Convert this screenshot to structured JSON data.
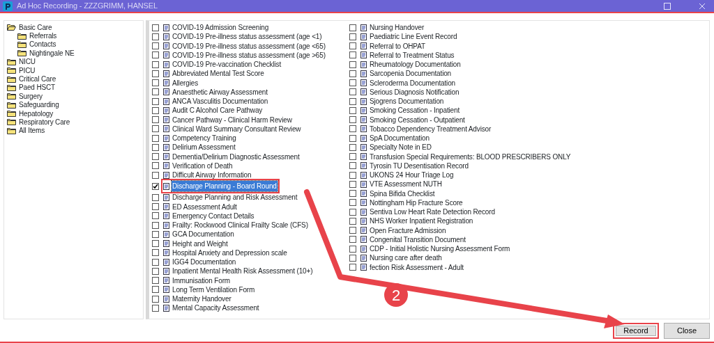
{
  "window": {
    "title": "Ad Hoc Recording - ZZZGRIMM, HANSEL"
  },
  "tree": [
    {
      "label": "Basic Care",
      "expanded": true,
      "children": [
        {
          "label": "Referrals"
        },
        {
          "label": "Contacts"
        },
        {
          "label": "Nightingale NE"
        }
      ]
    },
    {
      "label": "NICU",
      "expanded": false
    },
    {
      "label": "PICU",
      "expanded": false
    },
    {
      "label": "Critical Care",
      "expanded": false
    },
    {
      "label": "Paed HSCT",
      "expanded": false
    },
    {
      "label": "Surgery",
      "expanded": false
    },
    {
      "label": "Safeguarding",
      "expanded": false
    },
    {
      "label": "Hepatology",
      "expanded": false
    },
    {
      "label": "Respiratory Care",
      "expanded": false
    },
    {
      "label": "All Items",
      "expanded": false
    }
  ],
  "form_columns": [
    [
      {
        "label": "COVID-19 Admission Screening",
        "checked": false,
        "selected": false
      },
      {
        "label": "COVID-19 Pre-illness status assessment (age <1)",
        "checked": false,
        "selected": false
      },
      {
        "label": "COVID-19 Pre-illness status assessment (age <65)",
        "checked": false,
        "selected": false
      },
      {
        "label": "COVID-19 Pre-illness status assessment (age >65)",
        "checked": false,
        "selected": false
      },
      {
        "label": "COVID-19 Pre-vaccination Checklist",
        "checked": false,
        "selected": false
      },
      {
        "label": "Abbreviated Mental Test Score",
        "checked": false,
        "selected": false
      },
      {
        "label": "Allergies",
        "checked": false,
        "selected": false
      },
      {
        "label": "Anaesthetic Airway Assessment",
        "checked": false,
        "selected": false
      },
      {
        "label": "ANCA Vasculitis Documentation",
        "checked": false,
        "selected": false
      },
      {
        "label": "Audit C Alcohol Care Pathway",
        "checked": false,
        "selected": false
      },
      {
        "label": "Cancer Pathway - Clinical Harm Review",
        "checked": false,
        "selected": false
      },
      {
        "label": "Clinical Ward Summary Consultant Review",
        "checked": false,
        "selected": false
      },
      {
        "label": "Competency Training",
        "checked": false,
        "selected": false
      },
      {
        "label": "Delirium Assessment",
        "checked": false,
        "selected": false
      },
      {
        "label": "Dementia/Delirium Diagnostic Assessment",
        "checked": false,
        "selected": false
      },
      {
        "label": "Verification of Death",
        "checked": false,
        "selected": false
      },
      {
        "label": "Difficult Airway Information",
        "checked": false,
        "selected": false
      },
      {
        "label": "Discharge Planning - Board Round",
        "checked": true,
        "selected": true,
        "highlighted": true
      },
      {
        "label": "Discharge Planning and Risk Assessment",
        "checked": false,
        "selected": false
      },
      {
        "label": "ED Assessment Adult",
        "checked": false,
        "selected": false
      },
      {
        "label": "Emergency Contact Details",
        "checked": false,
        "selected": false
      },
      {
        "label": "Frailty: Rockwood Clinical Frailty Scale (CFS)",
        "checked": false,
        "selected": false
      },
      {
        "label": "GCA Documentation",
        "checked": false,
        "selected": false
      },
      {
        "label": "Height and Weight",
        "checked": false,
        "selected": false
      },
      {
        "label": "Hospital Anxiety and Depression scale",
        "checked": false,
        "selected": false
      },
      {
        "label": "IGG4 Documentation",
        "checked": false,
        "selected": false
      },
      {
        "label": "Inpatient Mental Health Risk Assessment (10+)",
        "checked": false,
        "selected": false
      },
      {
        "label": "Immunisation Form",
        "checked": false,
        "selected": false
      },
      {
        "label": "Long Term Ventilation Form",
        "checked": false,
        "selected": false
      },
      {
        "label": "Maternity Handover",
        "checked": false,
        "selected": false
      },
      {
        "label": "Mental Capacity Assessment",
        "checked": false,
        "selected": false
      }
    ],
    [
      {
        "label": "Nursing Handover",
        "checked": false,
        "selected": false
      },
      {
        "label": "Paediatric Line Event Record",
        "checked": false,
        "selected": false
      },
      {
        "label": "Referral to OHPAT",
        "checked": false,
        "selected": false
      },
      {
        "label": "Referral to Treatment Status",
        "checked": false,
        "selected": false
      },
      {
        "label": "Rheumatology Documentation",
        "checked": false,
        "selected": false
      },
      {
        "label": "Sarcopenia Documentation",
        "checked": false,
        "selected": false
      },
      {
        "label": "Scleroderma Documentation",
        "checked": false,
        "selected": false
      },
      {
        "label": "Serious Diagnosis Notification",
        "checked": false,
        "selected": false
      },
      {
        "label": "Sjogrens Documentation",
        "checked": false,
        "selected": false
      },
      {
        "label": "Smoking Cessation - Inpatient",
        "checked": false,
        "selected": false
      },
      {
        "label": "Smoking Cessation - Outpatient",
        "checked": false,
        "selected": false
      },
      {
        "label": "Tobacco Dependency Treatment Advisor",
        "checked": false,
        "selected": false
      },
      {
        "label": "SpA Documentation",
        "checked": false,
        "selected": false
      },
      {
        "label": "Specialty Note in ED",
        "checked": false,
        "selected": false
      },
      {
        "label": "Transfusion Special Requirements: BLOOD PRESCRIBERS ONLY",
        "checked": false,
        "selected": false
      },
      {
        "label": "Tyrosin TU Desentisation Record",
        "checked": false,
        "selected": false
      },
      {
        "label": "UKONS 24 Hour Triage Log",
        "checked": false,
        "selected": false
      },
      {
        "label": "VTE Assessment NUTH",
        "checked": false,
        "selected": false
      },
      {
        "label": "Spina Bifida Checklist",
        "checked": false,
        "selected": false
      },
      {
        "label": "Nottingham Hip Fracture Score",
        "checked": false,
        "selected": false
      },
      {
        "label": "Sentiva Low Heart Rate Detection Record",
        "checked": false,
        "selected": false
      },
      {
        "label": "NHS Worker Inpatient Registration",
        "checked": false,
        "selected": false
      },
      {
        "label": "Open Fracture Admission",
        "checked": false,
        "selected": false
      },
      {
        "label": "Congenital Transition Document",
        "checked": false,
        "selected": false
      },
      {
        "label": "CDP - Initial Holistic Nursing Assessment Form",
        "checked": false,
        "selected": false
      },
      {
        "label": "Nursing care after death",
        "checked": false,
        "selected": false
      },
      {
        "label": "fection Risk Assessment - Adult",
        "checked": false,
        "selected": false
      }
    ]
  ],
  "buttons": [
    {
      "label": "Record",
      "highlighted": true
    },
    {
      "label": "Close",
      "highlighted": false
    }
  ],
  "annotation": {
    "step": "2"
  }
}
